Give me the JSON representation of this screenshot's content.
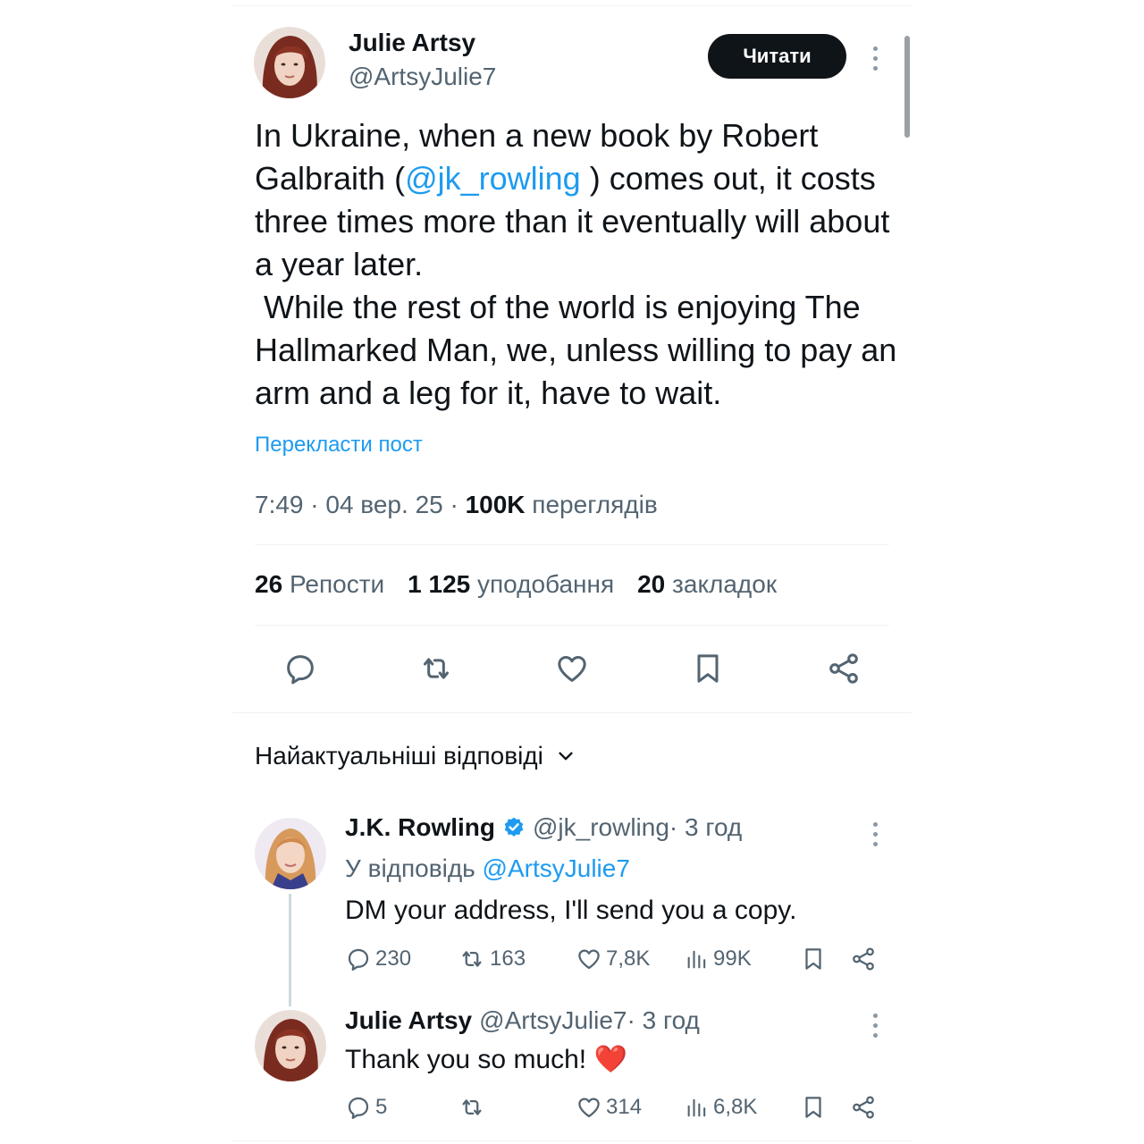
{
  "tweet": {
    "author_name": "Julie Artsy",
    "author_handle": "@ArtsyJulie7",
    "follow_label": "Читати",
    "text_before_mention": "In Ukraine, when a new book by Robert Galbraith (",
    "mention": "@jk_rowling",
    "text_after_mention": " ) comes out, it costs three times more than it eventually will about a year later.\n While the rest of the world is enjoying The Hallmarked Man, we, unless willing to pay an arm and a leg for it, have to wait.",
    "translate_label": "Перекласти пост",
    "timestamp": "7:49 · 04 вер. 25 · ",
    "views_count": "100K",
    "views_label": " переглядів",
    "reposts_count": "26",
    "reposts_label": "Репости",
    "likes_count": "1 125",
    "likes_label": "уподобання",
    "bookmarks_count": "20",
    "bookmarks_label": "закладок"
  },
  "actions": [
    "reply-icon",
    "repost-icon",
    "like-icon",
    "bookmark-icon",
    "share-icon"
  ],
  "replies_header": {
    "label": "Найактуальніші відповіді"
  },
  "replies": [
    {
      "author_name": "J.K. Rowling",
      "author_handle": "@jk_rowling",
      "time": " · 3 год",
      "verified": true,
      "replying_to_label": "У відповідь ",
      "replying_to_handle": "@ArtsyJulie7",
      "text": "DM your address, I'll send you a copy.",
      "replies": "230",
      "reposts": "163",
      "likes": "7,8K",
      "views": "99K"
    },
    {
      "author_name": "Julie Artsy",
      "author_handle": "@ArtsyJulie7",
      "time": " · 3 год",
      "text": "Thank you so much! ❤️",
      "replies": "5",
      "reposts": "",
      "likes": "314",
      "views": "6,8K"
    }
  ],
  "colors": {
    "link": "#1d9bf0",
    "muted": "#536471",
    "text": "#0f1419",
    "divider": "#eff3f4",
    "verified": "#1d9bf0",
    "heart": "#e0245e"
  }
}
